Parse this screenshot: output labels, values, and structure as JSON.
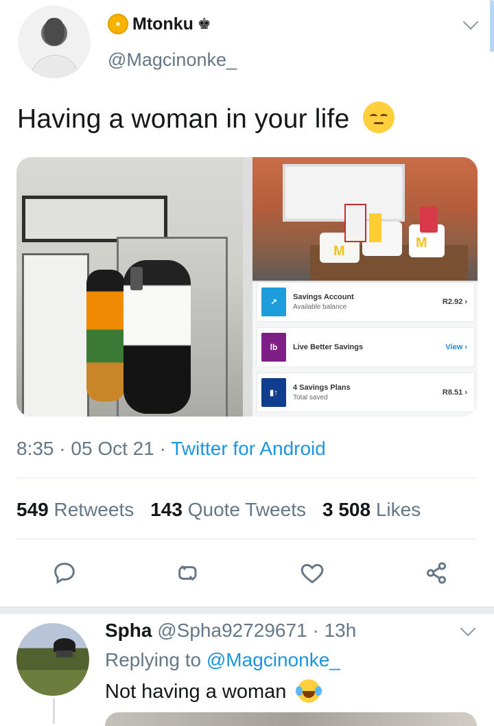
{
  "tweet": {
    "display_name": "Mtonku",
    "name_suffix_icon": "crown-icon",
    "handle": "@Magcinonke_",
    "text": "Having a woman in your life",
    "emoji_name": "pensive-face-emoji",
    "time": "8:35",
    "date": "05 Oct 21",
    "source": "Twitter for Android",
    "retweets_count": "549",
    "retweets_label": "Retweets",
    "quote_count": "143",
    "quote_label": "Quote Tweets",
    "likes_count": "3 508",
    "likes_label": "Likes",
    "media": {
      "bank_rows": [
        {
          "title": "Savings Account",
          "subtitle": "Available balance",
          "value": "R2.92"
        },
        {
          "title": "Live Better Savings",
          "subtitle": "",
          "value": "View"
        },
        {
          "title": "4 Savings Plans",
          "subtitle": "Total saved",
          "value": "R8.51"
        }
      ],
      "food_box_text": "M"
    }
  },
  "actions": {
    "reply_icon": "reply-icon",
    "retweet_icon": "retweet-icon",
    "like_icon": "like-icon",
    "share_icon": "share-icon"
  },
  "reply": {
    "display_name": "Spha",
    "handle": "@Spha92729671",
    "time_ago": "13h",
    "replying_label": "Replying to",
    "replying_to": "@Magcinonke_",
    "text": "Not having a woman",
    "emoji_name": "face-with-tears-of-joy-emoji"
  },
  "colors": {
    "link": "#1b95e0",
    "muted": "#657786",
    "text": "#14171a"
  }
}
